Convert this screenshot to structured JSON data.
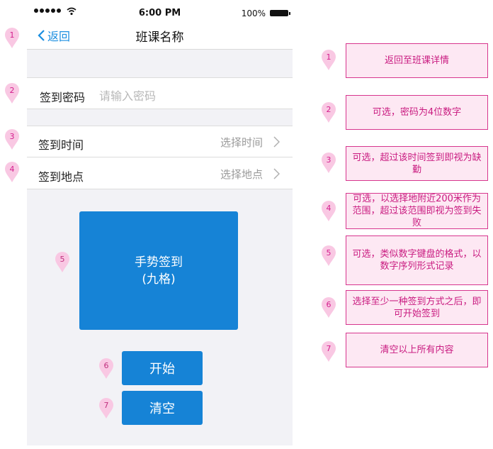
{
  "statusbar": {
    "time": "6:00 PM",
    "battery": "100%"
  },
  "navbar": {
    "back_label": "返回",
    "title": "班课名称"
  },
  "form": {
    "password": {
      "label": "签到密码",
      "placeholder": "请输入密码"
    },
    "time": {
      "label": "签到时间",
      "value": "选择时间"
    },
    "location": {
      "label": "签到地点",
      "value": "选择地点"
    }
  },
  "gesture": {
    "line1": "手势签到",
    "line2": "(九格)"
  },
  "buttons": {
    "start": "开始",
    "clear": "清空"
  },
  "markers": [
    "1",
    "2",
    "3",
    "4",
    "5",
    "6",
    "7"
  ],
  "notes": [
    "返回至班课详情",
    "可选，密码为4位数字",
    "可选，超过该时间签到即视为缺勤",
    "可选，以选择地附近200米作为范围，超过该范围即视为签到失败",
    "可选，类似数字键盘的格式，以数字序列形式记录",
    "选择至少一种签到方式之后，即可开始签到",
    "清空以上所有内容"
  ],
  "colors": {
    "accent": "#1683d6",
    "link": "#1a8ee0",
    "annotation": "#d41d8d",
    "annotation_bg": "#fde8f3"
  }
}
